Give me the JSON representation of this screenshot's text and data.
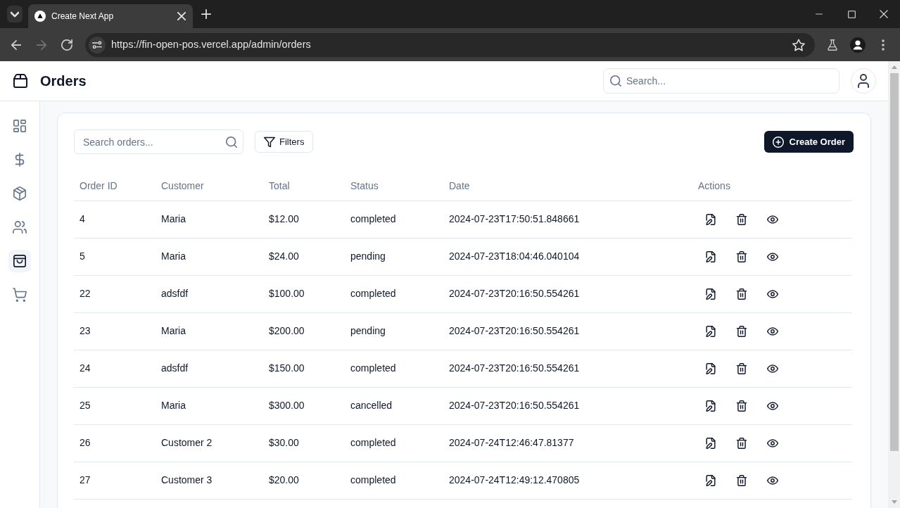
{
  "browser": {
    "tabs": [
      {
        "title": "Create Next App",
        "selected": true
      }
    ],
    "navigation": [
      {
        "kind": "back",
        "disabled": false
      },
      {
        "kind": "forward",
        "disabled": true
      },
      {
        "kind": "reload",
        "disabled": false
      }
    ],
    "address": "https://fin-open-pos.vercel.app/admin/orders"
  },
  "header": {
    "title": "Orders",
    "search": {
      "placeholder": "Search..."
    }
  },
  "sidebar": {
    "items": [
      {
        "kind": "dashboard",
        "selected": false
      },
      {
        "kind": "finance",
        "selected": false
      },
      {
        "kind": "products",
        "selected": false
      },
      {
        "kind": "customers",
        "selected": false
      },
      {
        "kind": "orders",
        "selected": true
      },
      {
        "kind": "pos",
        "selected": false
      }
    ]
  },
  "orders": {
    "search": {
      "placeholder": "Search orders..."
    },
    "filters_button": "Filters",
    "create_button": "Create Order",
    "table": {
      "columns": [
        "Order ID",
        "Customer",
        "Total",
        "Status",
        "Date",
        "Actions"
      ],
      "rows": [
        {
          "order_id": "4",
          "customer": "Maria",
          "total": "$12.00",
          "status": "completed",
          "date": "2024-07-23T17:50:51.848661"
        },
        {
          "order_id": "5",
          "customer": "Maria",
          "total": "$24.00",
          "status": "pending",
          "date": "2024-07-23T18:04:46.040104"
        },
        {
          "order_id": "22",
          "customer": "adsfdf",
          "total": "$100.00",
          "status": "completed",
          "date": "2024-07-23T20:16:50.554261"
        },
        {
          "order_id": "23",
          "customer": "Maria",
          "total": "$200.00",
          "status": "pending",
          "date": "2024-07-23T20:16:50.554261"
        },
        {
          "order_id": "24",
          "customer": "adsfdf",
          "total": "$150.00",
          "status": "completed",
          "date": "2024-07-23T20:16:50.554261"
        },
        {
          "order_id": "25",
          "customer": "Maria",
          "total": "$300.00",
          "status": "cancelled",
          "date": "2024-07-23T20:16:50.554261"
        },
        {
          "order_id": "26",
          "customer": "Customer 2",
          "total": "$30.00",
          "status": "completed",
          "date": "2024-07-24T12:46:47.81377"
        },
        {
          "order_id": "27",
          "customer": "Customer 3",
          "total": "$20.00",
          "status": "completed",
          "date": "2024-07-24T12:49:12.470805"
        }
      ]
    }
  }
}
